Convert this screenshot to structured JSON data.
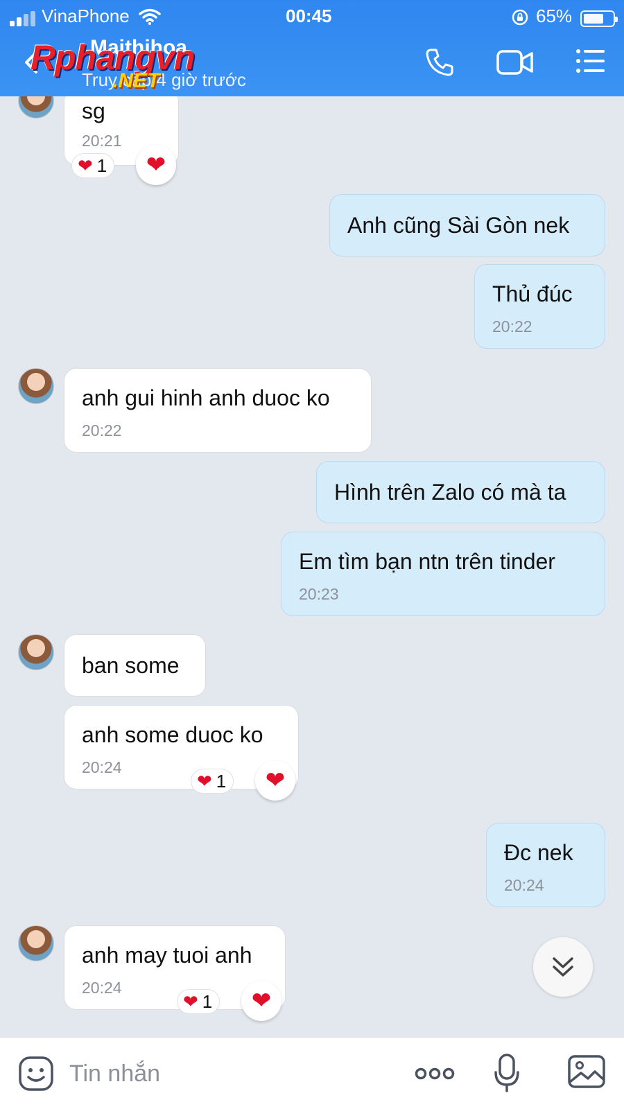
{
  "status_bar": {
    "carrier": "VinaPhone",
    "time": "00:45",
    "battery": "65%",
    "battery_level": 0.65
  },
  "header": {
    "title": "Maithihoa",
    "subtitle": "Truy cập 4 giờ trước",
    "watermark_main": "Rphangvn",
    "watermark_sub": ".NET",
    "icons": [
      "back-icon",
      "phone-icon",
      "video-call-icon",
      "menu-icon"
    ]
  },
  "messages": [
    {
      "side": "in",
      "text": "sg",
      "time": "20:21",
      "reaction_count": "1"
    },
    {
      "side": "out",
      "text": "Anh cũng Sài Gòn nek"
    },
    {
      "side": "out",
      "text": "Thủ đúc",
      "time": "20:22"
    },
    {
      "side": "in",
      "text": "anh gui hinh anh duoc ko",
      "time": "20:22"
    },
    {
      "side": "out",
      "text": "Hình trên Zalo có mà ta"
    },
    {
      "side": "out",
      "text": "Em tìm bạn ntn trên tinder",
      "time": "20:23"
    },
    {
      "side": "in",
      "text": "ban some"
    },
    {
      "side": "in",
      "text": "anh some duoc ko",
      "time": "20:24",
      "reaction_count": "1"
    },
    {
      "side": "out",
      "text": "Đc nek",
      "time": "20:24"
    },
    {
      "side": "in",
      "text": "anh may tuoi anh",
      "time": "20:24",
      "reaction_count": "1"
    }
  ],
  "composer": {
    "placeholder": "Tin nhắn",
    "icons": [
      "sticker-icon",
      "more-icon",
      "microphone-icon",
      "gallery-icon"
    ]
  },
  "colors": {
    "header": "#2f87f0",
    "chat_background": "#e3e7ee",
    "incoming_bubble": "#ffffff",
    "outgoing_bubble": "#d5ecfb",
    "reaction_heart": "#e0102a"
  }
}
